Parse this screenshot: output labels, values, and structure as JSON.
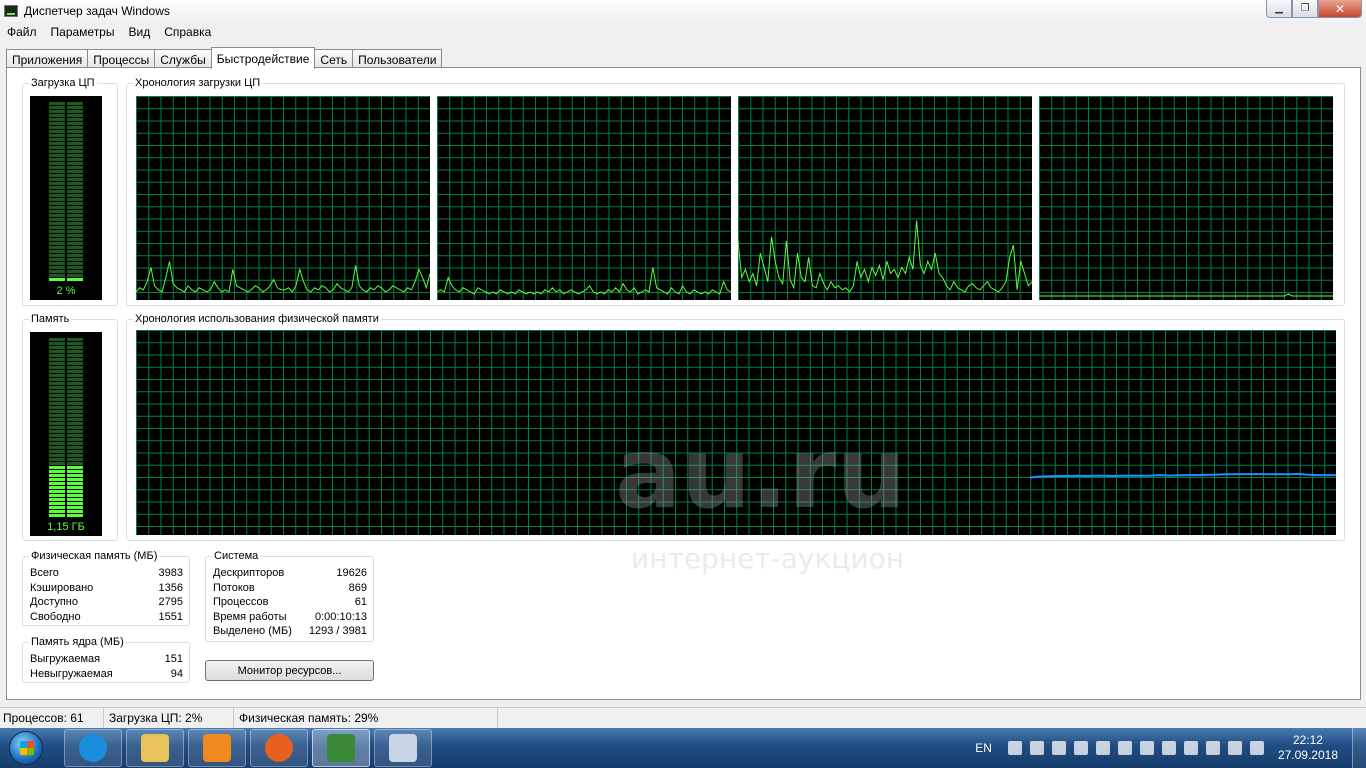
{
  "window": {
    "title": "Диспетчер задач Windows"
  },
  "menu": [
    "Файл",
    "Параметры",
    "Вид",
    "Справка"
  ],
  "tabs": [
    "Приложения",
    "Процессы",
    "Службы",
    "Быстродействие",
    "Сеть",
    "Пользователи"
  ],
  "active_tab_index": 3,
  "cpu": {
    "usage_label": "Загрузка ЦП",
    "usage_value": "2 %",
    "usage_level": 0.02,
    "history_label": "Хронология загрузки ЦП",
    "cores": [
      [
        3,
        5,
        4,
        8,
        15,
        6,
        4,
        3,
        10,
        18,
        7,
        5,
        4,
        3,
        6,
        4,
        3,
        5,
        4,
        3,
        4,
        8,
        5,
        3,
        4,
        3,
        14,
        6,
        5,
        4,
        3,
        4,
        6,
        5,
        3,
        4,
        6,
        9,
        5,
        4,
        4,
        5,
        3,
        6,
        14,
        8,
        4,
        3,
        5,
        4,
        6,
        5,
        3,
        4,
        7,
        5,
        4,
        3,
        5,
        16,
        6,
        4,
        3,
        5,
        4,
        6,
        5,
        3,
        4,
        6,
        5,
        4,
        3,
        5,
        4,
        8,
        14,
        10,
        5,
        12
      ],
      [
        3,
        4,
        3,
        10,
        6,
        4,
        3,
        5,
        4,
        3,
        2,
        5,
        4,
        3,
        2,
        3,
        2,
        4,
        3,
        2,
        3,
        2,
        4,
        3,
        2,
        3,
        2,
        3,
        2,
        4,
        3,
        5,
        3,
        4,
        2,
        3,
        4,
        3,
        2,
        3,
        4,
        6,
        3,
        2,
        3,
        2,
        4,
        3,
        5,
        3,
        7,
        4,
        3,
        5,
        2,
        3,
        4,
        3,
        15,
        5,
        4,
        3,
        2,
        5,
        3,
        2,
        6,
        3,
        2,
        4,
        3,
        2,
        3,
        2,
        4,
        3,
        2,
        8,
        4,
        3
      ],
      [
        28,
        10,
        14,
        8,
        12,
        6,
        22,
        15,
        8,
        30,
        18,
        10,
        7,
        28,
        9,
        5,
        22,
        10,
        8,
        20,
        6,
        5,
        12,
        7,
        4,
        8,
        5,
        6,
        4,
        5,
        3,
        6,
        18,
        10,
        14,
        8,
        15,
        11,
        16,
        9,
        18,
        12,
        14,
        10,
        15,
        12,
        20,
        14,
        38,
        16,
        12,
        18,
        14,
        22,
        12,
        10,
        6,
        4,
        8,
        5,
        4,
        3,
        6,
        7,
        5,
        4,
        6,
        8,
        5,
        4,
        3,
        5,
        8,
        20,
        26,
        4,
        18,
        12,
        6,
        8
      ],
      [
        1,
        1,
        1,
        1,
        1,
        1,
        1,
        1,
        1,
        1,
        1,
        1,
        1,
        1,
        1,
        1,
        1,
        1,
        1,
        1,
        1,
        1,
        1,
        1,
        1,
        1,
        1,
        1,
        1,
        1,
        1,
        1,
        1,
        1,
        1,
        1,
        1,
        1,
        1,
        1,
        1,
        1,
        1,
        1,
        1,
        1,
        1,
        1,
        1,
        1,
        1,
        1,
        1,
        1,
        1,
        1,
        1,
        1,
        1,
        1,
        1,
        1,
        1,
        1,
        1,
        1,
        1,
        2,
        1,
        1,
        1,
        1,
        1,
        1,
        1,
        1,
        1,
        1,
        1,
        1
      ]
    ]
  },
  "memory": {
    "usage_label": "Память",
    "usage_value": "1,15 ГБ",
    "usage_level": 0.29,
    "history_label": "Хронология использования физической памяти",
    "history_start_fraction": 0.745,
    "history": [
      28,
      28.5,
      28.7,
      28.8,
      28.8,
      28.9,
      28.8,
      28.9,
      28.9,
      28.8,
      28.9,
      29,
      28.9,
      29,
      29.2,
      29,
      29.1,
      29.2,
      29.2,
      29.3,
      29.4,
      29.6,
      29.6,
      29.7,
      29.7,
      29.7,
      29.6,
      29.7,
      29.6,
      29.8,
      29.4,
      29.2,
      29.2,
      29.2
    ]
  },
  "physical_memory": {
    "label": "Физическая память (МБ)",
    "rows": [
      {
        "label": "Всего",
        "value": "3983"
      },
      {
        "label": "Кэшировано",
        "value": "1356"
      },
      {
        "label": "Доступно",
        "value": "2795"
      },
      {
        "label": "Свободно",
        "value": "1551"
      }
    ]
  },
  "kernel_memory": {
    "label": "Память ядра (МБ)",
    "rows": [
      {
        "label": "Выгружаемая",
        "value": "151"
      },
      {
        "label": "Невыгружаемая",
        "value": "94"
      }
    ]
  },
  "system": {
    "label": "Система",
    "rows": [
      {
        "label": "Дескрипторов",
        "value": "19626"
      },
      {
        "label": "Потоков",
        "value": "869"
      },
      {
        "label": "Процессов",
        "value": "61"
      },
      {
        "label": "Время работы",
        "value": "0:00:10:13"
      },
      {
        "label": "Выделено (МБ)",
        "value": "1293 / 3981"
      }
    ]
  },
  "monitor_button": "Монитор ресурсов...",
  "watermark": {
    "main": "au.ru",
    "sub": "интернет-аукцион"
  },
  "statusbar": {
    "processes": "Процессов: 61",
    "cpu": "Загрузка ЦП: 2%",
    "memory": "Физическая память: 29%"
  },
  "colors": {
    "graph_bg": "#000000",
    "grid": "#008040",
    "cpu_line": "#59ff3a",
    "mem_line": "#1e90ff",
    "meter_lit": "#59ff3a",
    "meter_dim": "#1d5a1d"
  },
  "taskbar": {
    "items": [
      {
        "name": "internet-explorer",
        "color": "#1a8fe0"
      },
      {
        "name": "file-explorer",
        "color": "#e8c25a"
      },
      {
        "name": "media-player",
        "color": "#f08a1e"
      },
      {
        "name": "firefox",
        "color": "#e8601e"
      },
      {
        "name": "task-manager",
        "color": "#3a8a3a"
      },
      {
        "name": "paint",
        "color": "#c9d4e6"
      }
    ],
    "lang": "EN",
    "time": "22:12",
    "date": "27.09.2018"
  }
}
